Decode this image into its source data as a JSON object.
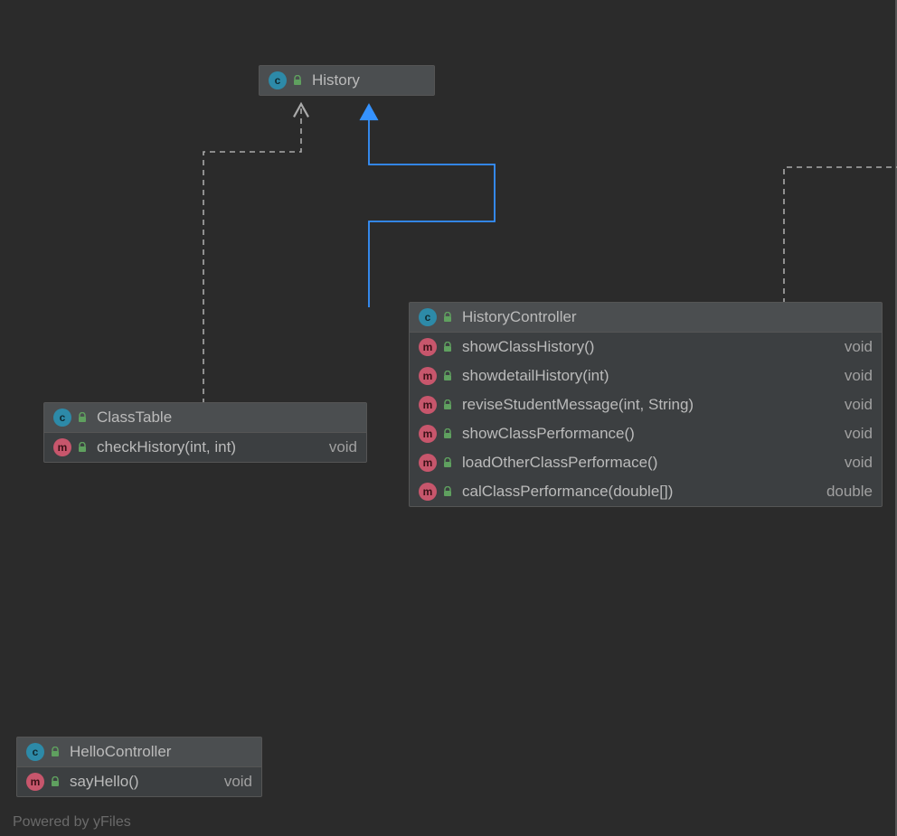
{
  "footer": "Powered by yFiles",
  "classes": {
    "history": {
      "name": "History",
      "members": []
    },
    "classTable": {
      "name": "ClassTable",
      "members": [
        {
          "sig": "checkHistory(int, int)",
          "ret": "void"
        }
      ]
    },
    "historyController": {
      "name": "HistoryController",
      "members": [
        {
          "sig": "showClassHistory()",
          "ret": "void"
        },
        {
          "sig": "showdetailHistory(int)",
          "ret": "void"
        },
        {
          "sig": "reviseStudentMessage(int, String)",
          "ret": "void"
        },
        {
          "sig": "showClassPerformance()",
          "ret": "void"
        },
        {
          "sig": "loadOtherClassPerformace()",
          "ret": "void"
        },
        {
          "sig": "calClassPerformance(double[])",
          "ret": "double"
        }
      ]
    },
    "helloController": {
      "name": "HelloController",
      "members": [
        {
          "sig": "sayHello()",
          "ret": "void"
        }
      ]
    }
  },
  "relationships": [
    {
      "from": "classTable",
      "to": "history",
      "type": "dependency"
    },
    {
      "from": "historyController",
      "to": "history",
      "type": "association"
    },
    {
      "from": "historyController",
      "to": "_offscreen_right",
      "type": "dependency"
    }
  ]
}
